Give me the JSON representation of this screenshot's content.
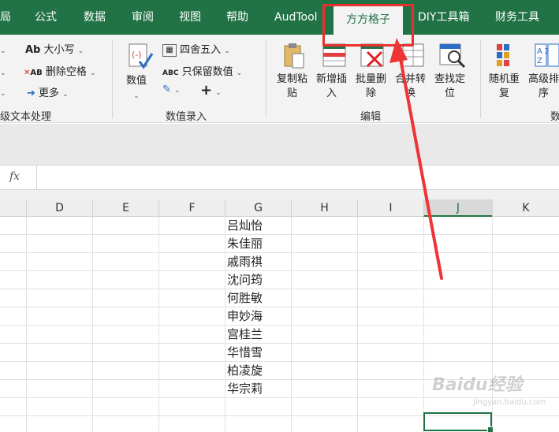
{
  "tabs": [
    "局",
    "公式",
    "数据",
    "审阅",
    "视图",
    "帮助",
    "AudTool",
    "方方格子",
    "DIY工具箱",
    "财务工具"
  ],
  "ribbon": {
    "text_group": {
      "case_label": "大小写",
      "remove_spaces_label": "删除空格",
      "more_label": "更多",
      "group_label": "级文本处理"
    },
    "number_group": {
      "number_label": "数值",
      "round_label": "四舍五入",
      "keep_numbers_label": "只保留数值",
      "group_label": "数值录入"
    },
    "edit_group": {
      "copy_paste_label": "复制粘\n贴",
      "insert_label": "新增插\n入",
      "batch_delete_label": "批量删\n除",
      "merge_label": "合并转\n换",
      "find_label": "查找定\n位",
      "group_label": "编辑"
    },
    "data_group": {
      "random_label": "随机重\n复",
      "sort_label": "高级排\n序",
      "group_label": "数"
    },
    "icon_text_ab": "Ab",
    "icon_text_abc": "ABC",
    "icon_text_xab": "AB",
    "icon_text_az": "A Z"
  },
  "formula_bar": {
    "fx": "fx",
    "value": ""
  },
  "columns": [
    "D",
    "E",
    "F",
    "G",
    "H",
    "I",
    "J",
    "K"
  ],
  "selected_column": "J",
  "names": [
    "吕灿怡",
    "朱佳丽",
    "戚雨祺",
    "沈问筠",
    "何胜敏",
    "申妙海",
    "宫桂兰",
    "华惜雪",
    "柏凌旋",
    "华宗莉"
  ],
  "watermark": {
    "text": "Baidu经验",
    "sub": "jingyan.baidu.com"
  },
  "colors": {
    "accent": "#217346",
    "highlight": "#e8312f"
  }
}
